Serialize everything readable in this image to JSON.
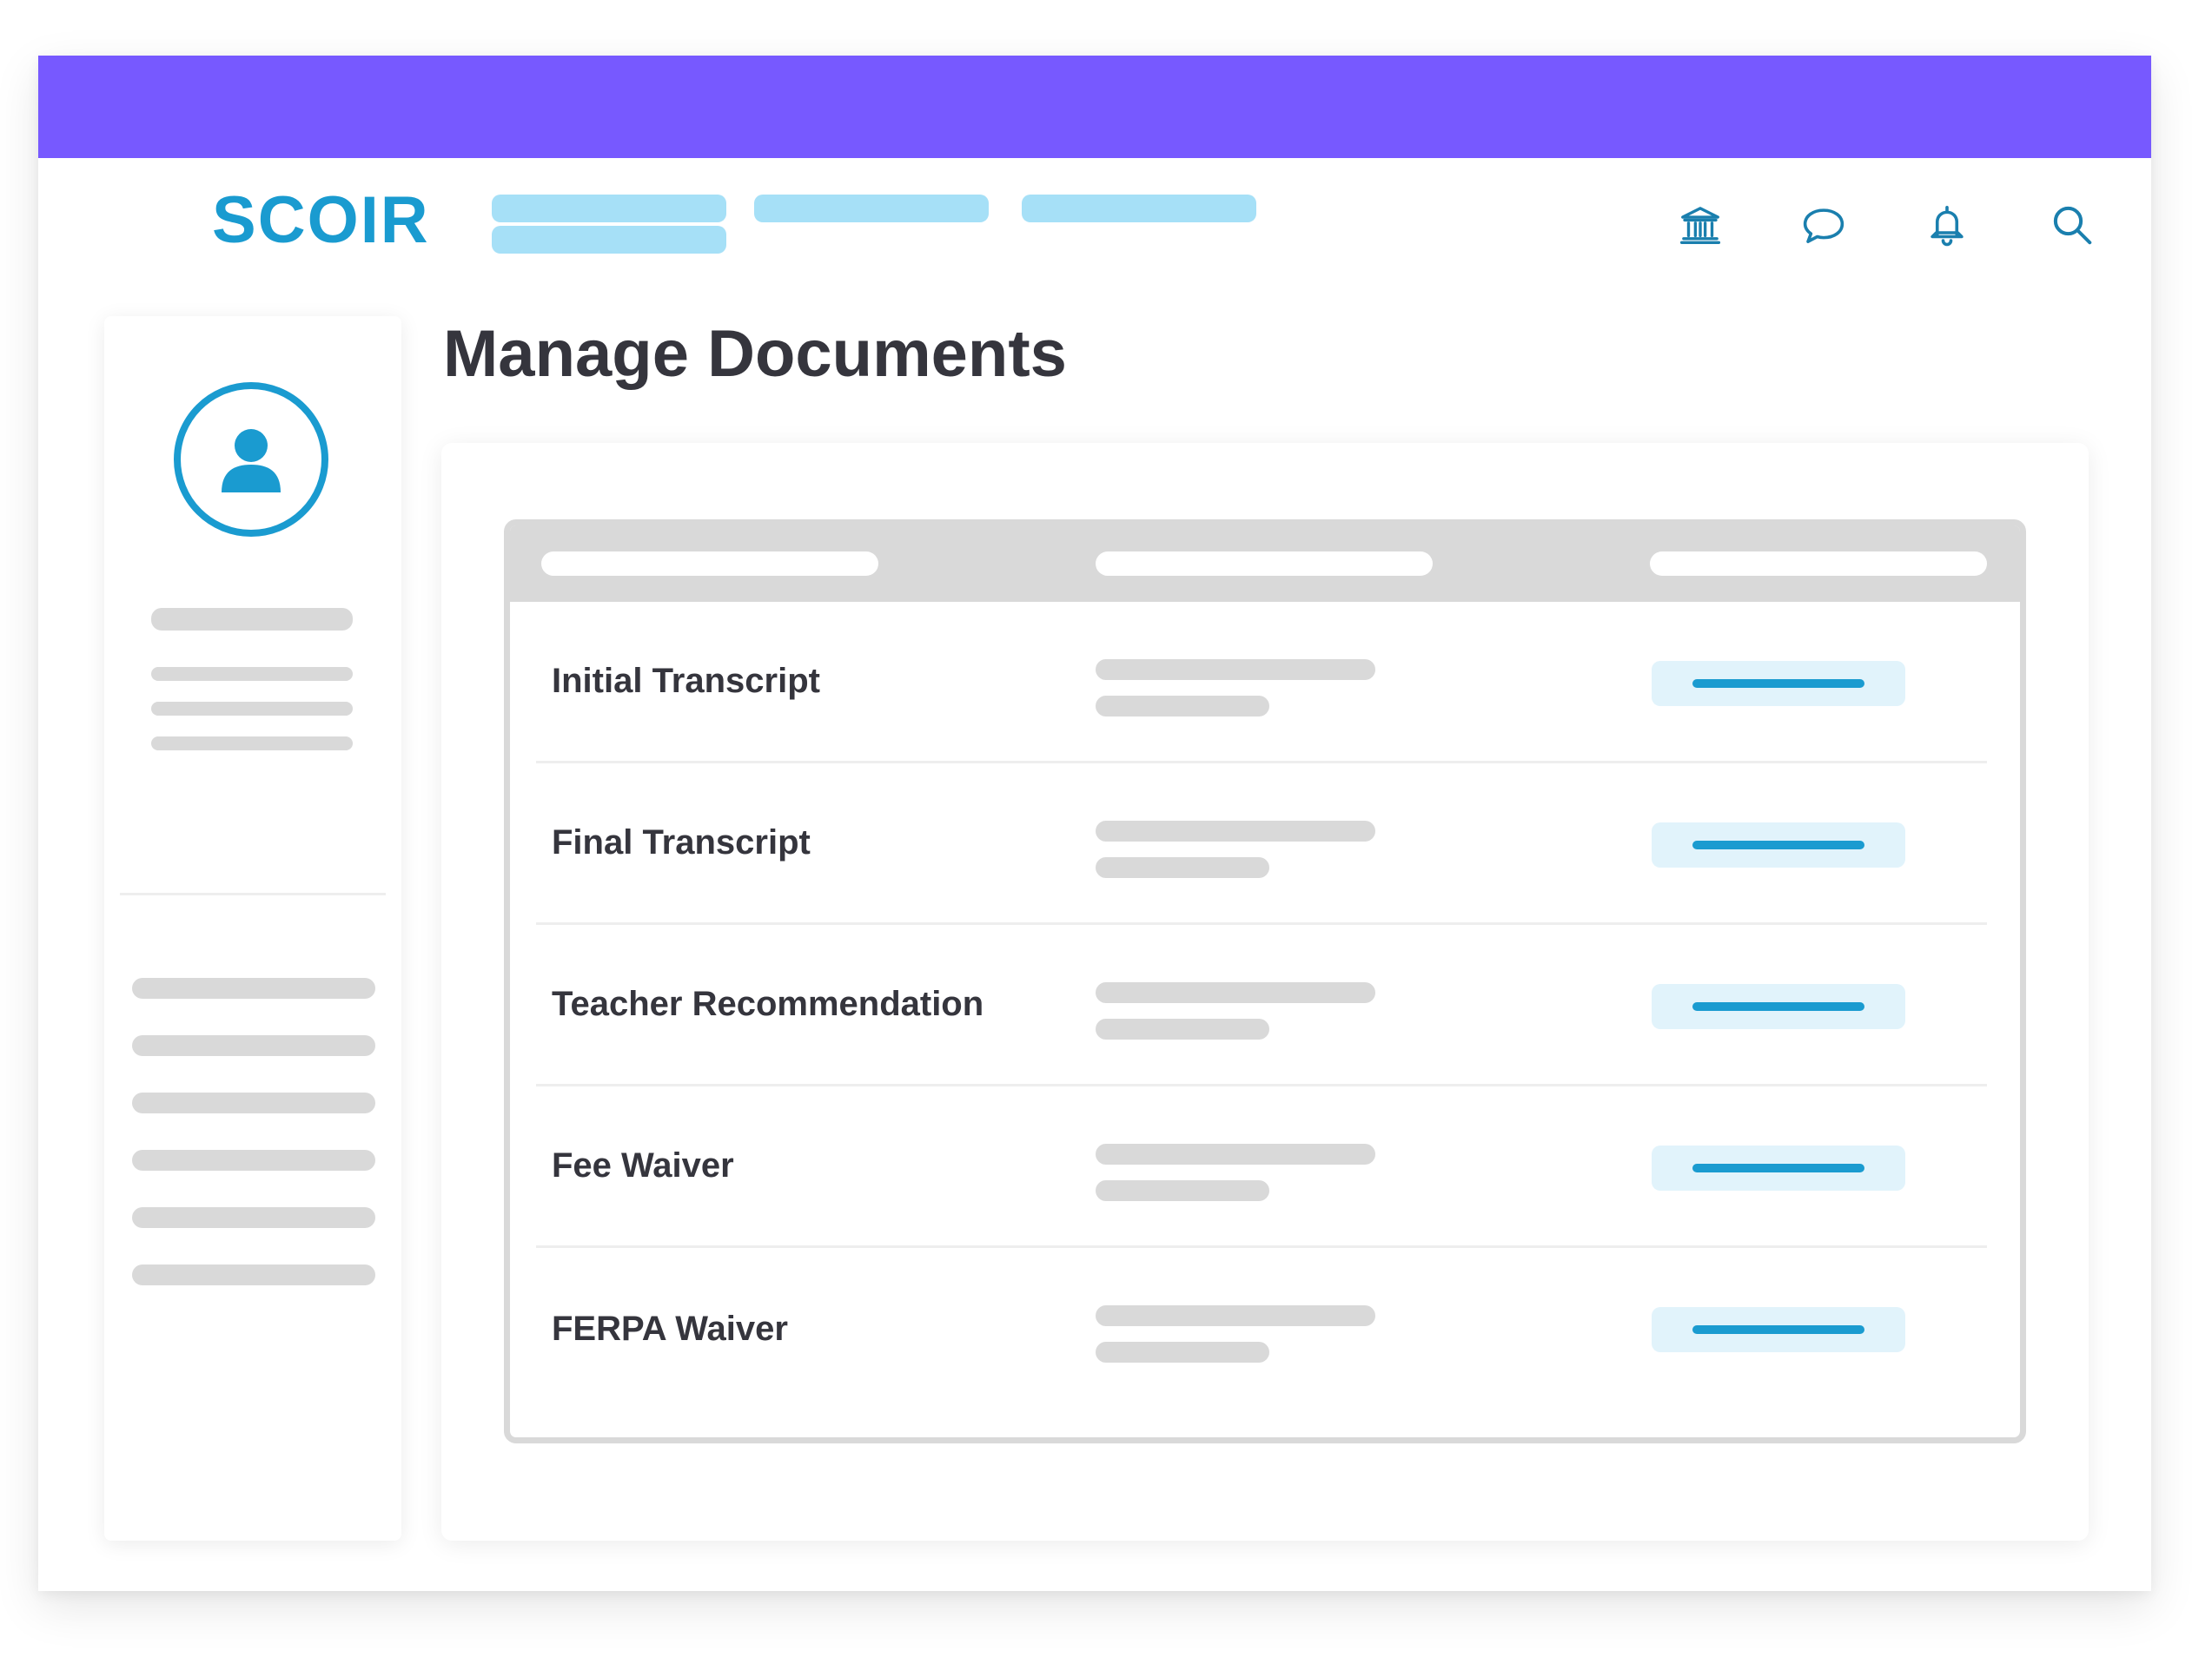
{
  "colors": {
    "accent": "#7759ff",
    "brand": "#1a9bd0",
    "placeholder": "#d9d9d9",
    "nav_placeholder": "#a6e0f7",
    "action_bg": "#e1f3fb",
    "title_text": "#35353d"
  },
  "header": {
    "logo": "SCOIR",
    "icons": [
      "institution-icon",
      "chat-bubble-icon",
      "bell-icon",
      "search-icon"
    ]
  },
  "main": {
    "title": "Manage Documents",
    "documents": [
      {
        "name": "Initial Transcript"
      },
      {
        "name": "Final Transcript"
      },
      {
        "name": "Teacher Recommendation"
      },
      {
        "name": "Fee Waiver"
      },
      {
        "name": "FERPA Waiver"
      }
    ]
  }
}
